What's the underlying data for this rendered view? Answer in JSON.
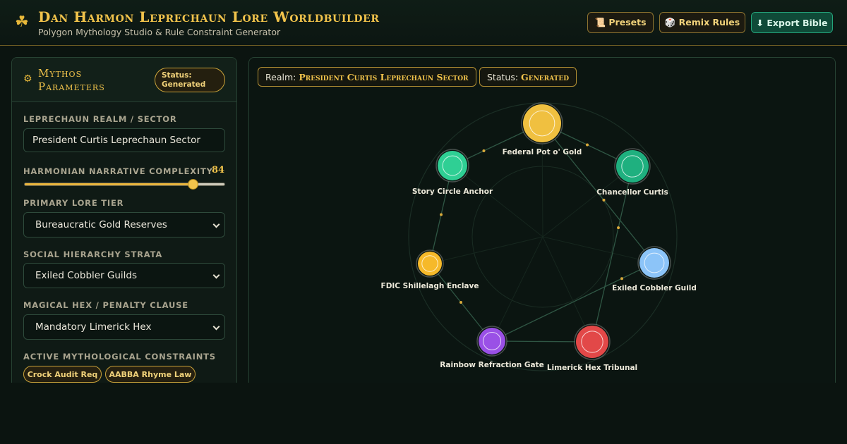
{
  "header": {
    "title": "Dan Harmon Leprechaun Lore Worldbuilder",
    "subtitle": "Polygon Mythology Studio & Rule Constraint Generator",
    "buttons": {
      "presets": "📜 Presets",
      "remix": "🎲 Remix Rules",
      "export": "⬇ Export Bible"
    }
  },
  "sidebar": {
    "title": "Mythos Parameters",
    "status_line1": "Status:",
    "status_line2": "Generated",
    "realm_label": "LEPRECHAUN REALM / SECTOR",
    "realm_value": "President Curtis Leprechaun Sector",
    "complexity_label": "HARMONIAN NARRATIVE COMPLEXITY",
    "complexity_value": 84,
    "lore_tier_label": "PRIMARY LORE TIER",
    "lore_tier_value": "Bureaucratic Gold Reserves",
    "hierarchy_label": "SOCIAL HIERARCHY STRATA",
    "hierarchy_value": "Exiled Cobbler Guilds",
    "hex_label": "MAGICAL HEX / PENALTY CLAUSE",
    "hex_value": "Mandatory Limerick Hex",
    "constraints_label": "ACTIVE MYTHOLOGICAL CONSTRAINTS",
    "constraints": [
      "Crock Audit Req",
      "AABBA Rhyme Law"
    ]
  },
  "main": {
    "realm_prefix": "Realm:",
    "realm_value": "President Curtis Leprechaun Sector",
    "status_prefix": "Status:",
    "status_value": "Generated"
  },
  "graph": {
    "colors": {
      "gold": "#f0c040",
      "emerald": "#1fb07f",
      "mint": "#2fcf94",
      "sky": "#8cc4f8",
      "crimson": "#e24848",
      "violet": "#9a50e6",
      "amber": "#f6b92a"
    },
    "nodes": [
      {
        "id": "federal-pot",
        "label": "Federal Pot o' Gold",
        "color": "#f0c040"
      },
      {
        "id": "chancellor",
        "label": "Chancellor Curtis",
        "color": "#1fb07f"
      },
      {
        "id": "cobbler",
        "label": "Exiled Cobbler Guild",
        "color": "#8cc4f8"
      },
      {
        "id": "limerick",
        "label": "Limerick Hex Tribunal",
        "color": "#e24848"
      },
      {
        "id": "rainbow",
        "label": "Rainbow Refraction Gate",
        "color": "#9a50e6"
      },
      {
        "id": "fdic",
        "label": "FDIC Shillelagh Enclave",
        "color": "#f6b92a"
      },
      {
        "id": "story-circle",
        "label": "Story Circle Anchor",
        "color": "#2fcf94"
      }
    ],
    "edges": [
      [
        "story-circle",
        "federal-pot"
      ],
      [
        "federal-pot",
        "chancellor"
      ],
      [
        "federal-pot",
        "cobbler"
      ],
      [
        "story-circle",
        "fdic"
      ],
      [
        "fdic",
        "rainbow"
      ],
      [
        "rainbow",
        "limerick"
      ],
      [
        "rainbow",
        "cobbler"
      ],
      [
        "chancellor",
        "limerick"
      ]
    ]
  }
}
